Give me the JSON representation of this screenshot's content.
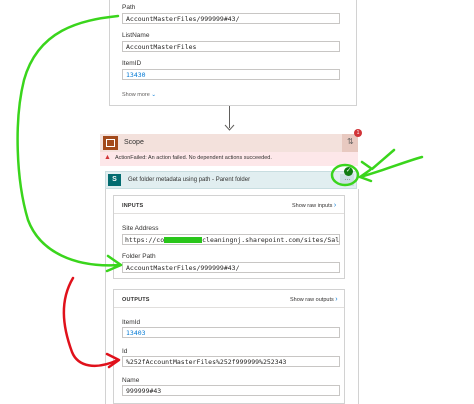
{
  "top_card": {
    "path_label": "Path",
    "path_value": "AccountMasterFiles/999999#43/",
    "listname_label": "ListName",
    "listname_value": "AccountMasterFiles",
    "itemid_label": "ItemID",
    "itemid_value": "13430",
    "show_more": "Show more"
  },
  "scope": {
    "title": "Scope",
    "error_text": "ActionFailed: An action failed. No dependent actions succeeded.",
    "error_badge": "1"
  },
  "action": {
    "title": "Get folder metadata using path - Parent folder"
  },
  "inputs": {
    "header": "INPUTS",
    "show_raw": "Show raw inputs",
    "site_address_label": "Site Address",
    "site_address_prefix": "https://co",
    "site_address_suffix": "cleaningnj.sharepoint.com/sites/SalesAccoun",
    "folder_path_label": "Folder Path",
    "folder_path_value": "AccountMasterFiles/999999#43/"
  },
  "outputs": {
    "header": "OUTPUTS",
    "show_raw": "Show raw outputs",
    "itemid_label": "ItemId",
    "itemid_value": "13403",
    "id_label": "Id",
    "id_value": "%252fAccountMasterFiles%252f999999%252343",
    "name_label": "Name",
    "name_value": "999999#43"
  },
  "colors": {
    "scope_bg": "#f3e1dc",
    "scope_icon": "#a34a1b",
    "error_bg": "#fde7e9",
    "action_bg": "#e1eef0",
    "sharepoint_icon": "#036c70",
    "success": "#107c10",
    "annotation_green": "#3ad51c",
    "annotation_red": "#e0111b"
  }
}
